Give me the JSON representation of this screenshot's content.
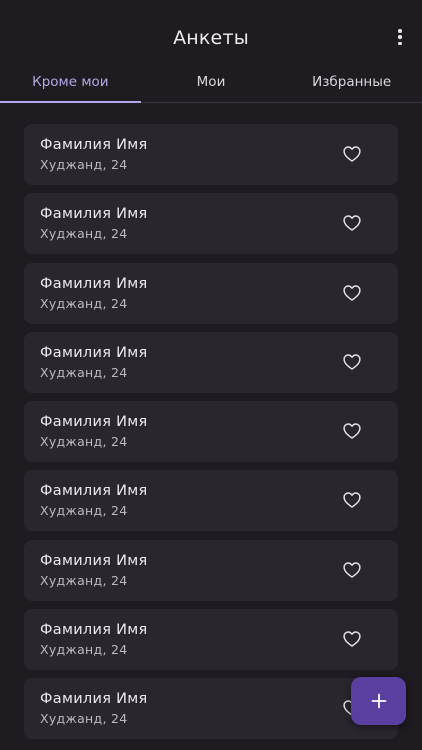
{
  "header": {
    "title": "Анкеты",
    "menu_icon": "more-vertical-icon"
  },
  "tabs": [
    {
      "label": "Кроме мои",
      "active": true
    },
    {
      "label": "Мои",
      "active": false
    },
    {
      "label": "Избранные",
      "active": false
    }
  ],
  "cards": [
    {
      "name": "Фамилия Имя",
      "location": "Худжанд, 24"
    },
    {
      "name": "Фамилия Имя",
      "location": "Худжанд, 24"
    },
    {
      "name": "Фамилия Имя",
      "location": "Худжанд, 24"
    },
    {
      "name": "Фамилия Имя",
      "location": "Худжанд, 24"
    },
    {
      "name": "Фамилия Имя",
      "location": "Худжанд, 24"
    },
    {
      "name": "Фамилия Имя",
      "location": "Худжанд, 24"
    },
    {
      "name": "Фамилия Имя",
      "location": "Худжанд, 24"
    },
    {
      "name": "Фамилия Имя",
      "location": "Худжанд, 24"
    },
    {
      "name": "Фамилия Имя",
      "location": "Худжанд, 24"
    }
  ],
  "fab": {
    "icon": "plus-icon"
  },
  "colors": {
    "background": "#1e1b21",
    "card": "#29262d",
    "accent": "#b9a6e8",
    "fab": "#5a3fa0"
  }
}
